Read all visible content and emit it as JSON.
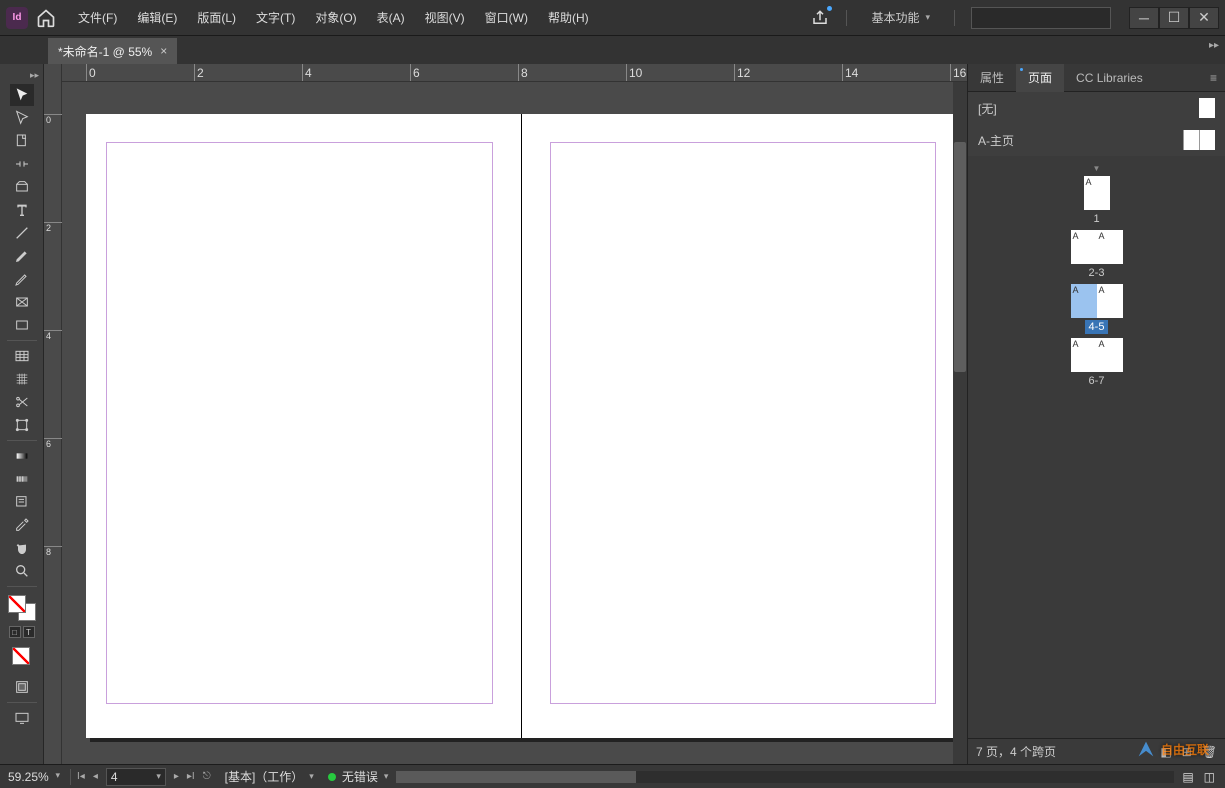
{
  "app": {
    "logo": "Id"
  },
  "menus": [
    "文件(F)",
    "编辑(E)",
    "版面(L)",
    "文字(T)",
    "对象(O)",
    "表(A)",
    "视图(V)",
    "窗口(W)",
    "帮助(H)"
  ],
  "workspace": "基本功能",
  "doc_tab": {
    "title": "*未命名-1 @ 55%",
    "close": "×"
  },
  "ruler_h": [
    "0",
    "2",
    "4",
    "6",
    "8",
    "10",
    "12",
    "14",
    "16"
  ],
  "ruler_v": [
    "0",
    "2",
    "4",
    "6",
    "8"
  ],
  "right_panel": {
    "tabs": {
      "properties": "属性",
      "pages": "页面",
      "cc": "CC Libraries"
    },
    "masters": {
      "none": "[无]",
      "a": "A-主页"
    },
    "pages": [
      {
        "label": "1",
        "thumbs": [
          "A"
        ],
        "selected": false
      },
      {
        "label": "2-3",
        "thumbs": [
          "A",
          "A"
        ],
        "selected": false
      },
      {
        "label": "4-5",
        "thumbs": [
          "A",
          "A"
        ],
        "selected": true
      },
      {
        "label": "6-7",
        "thumbs": [
          "A",
          "A"
        ],
        "selected": false
      }
    ],
    "status": "7 页，4 个跨页"
  },
  "statusbar": {
    "zoom": "59.25%",
    "page": "4",
    "layer": "[基本]（工作）",
    "errors": "无错误"
  },
  "watermark": "自由互联"
}
